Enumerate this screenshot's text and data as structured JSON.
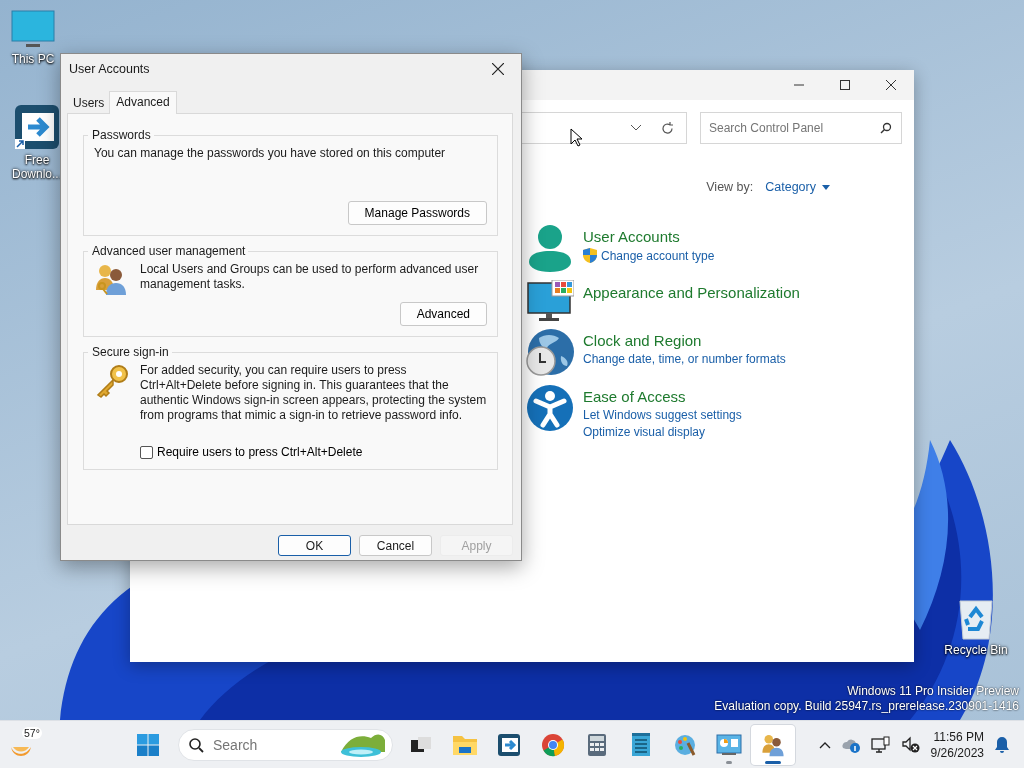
{
  "desktop": {
    "icons": [
      {
        "label": "This PC"
      },
      {
        "label": "Free Downlo..."
      },
      {
        "label": "Recycle Bin"
      }
    ],
    "build_info": [
      "Windows 11 Pro Insider Preview",
      "Evaluation copy. Build 25947.rs_prerelease.230901-1416"
    ]
  },
  "control_panel": {
    "search": {
      "placeholder": "Search Control Panel"
    },
    "view_by": {
      "label": "View by:",
      "value": "Category"
    },
    "categories": [
      {
        "title": "User Accounts",
        "links": [
          {
            "text": "Change account type",
            "shield": true
          }
        ]
      },
      {
        "title": "Appearance and Personalization"
      },
      {
        "title": "Clock and Region",
        "links": [
          {
            "text": "Change date, time, or number formats",
            "shield": false
          }
        ]
      },
      {
        "title": "Ease of Access",
        "links": [
          {
            "text": "Let Windows suggest settings",
            "shield": false
          },
          {
            "text": "Optimize visual display",
            "shield": false
          }
        ]
      }
    ]
  },
  "dialog": {
    "title": "User Accounts",
    "tabs": [
      {
        "label": "Users",
        "selected": false
      },
      {
        "label": "Advanced",
        "selected": true
      }
    ],
    "groups": [
      {
        "kind": "button",
        "title": "Passwords",
        "text": "You can manage the passwords you have stored on this computer",
        "button": "Manage Passwords"
      },
      {
        "kind": "button",
        "title": "Advanced user management",
        "text": "Local Users and Groups can be used to perform advanced user management tasks.",
        "button": "Advanced"
      },
      {
        "kind": "checkbox",
        "title": "Secure sign-in",
        "text": "For added security, you can require users to press Ctrl+Alt+Delete before signing in. This guarantees that the authentic Windows sign-in screen appears, protecting the system from programs that mimic a sign-in to retrieve password info.",
        "checkbox": {
          "label": "Require users to press Ctrl+Alt+Delete",
          "checked": false
        }
      }
    ],
    "buttons": [
      {
        "label": "OK",
        "default": true,
        "disabled": false
      },
      {
        "label": "Cancel",
        "default": false,
        "disabled": false
      },
      {
        "label": "Apply",
        "default": false,
        "disabled": true
      }
    ]
  },
  "taskbar": {
    "weather": "57°",
    "search": {
      "placeholder": "Search"
    },
    "apps": [
      {
        "running": false,
        "selected": false
      },
      {
        "running": false,
        "selected": false
      },
      {
        "running": false,
        "selected": false
      },
      {
        "running": false,
        "selected": false
      },
      {
        "running": false,
        "selected": false
      },
      {
        "running": false,
        "selected": false
      },
      {
        "running": false,
        "selected": false
      },
      {
        "running": true,
        "selected": false
      },
      {
        "running": true,
        "selected": true
      }
    ],
    "clock": {
      "time": "11:56 PM",
      "date": "9/26/2023"
    }
  }
}
